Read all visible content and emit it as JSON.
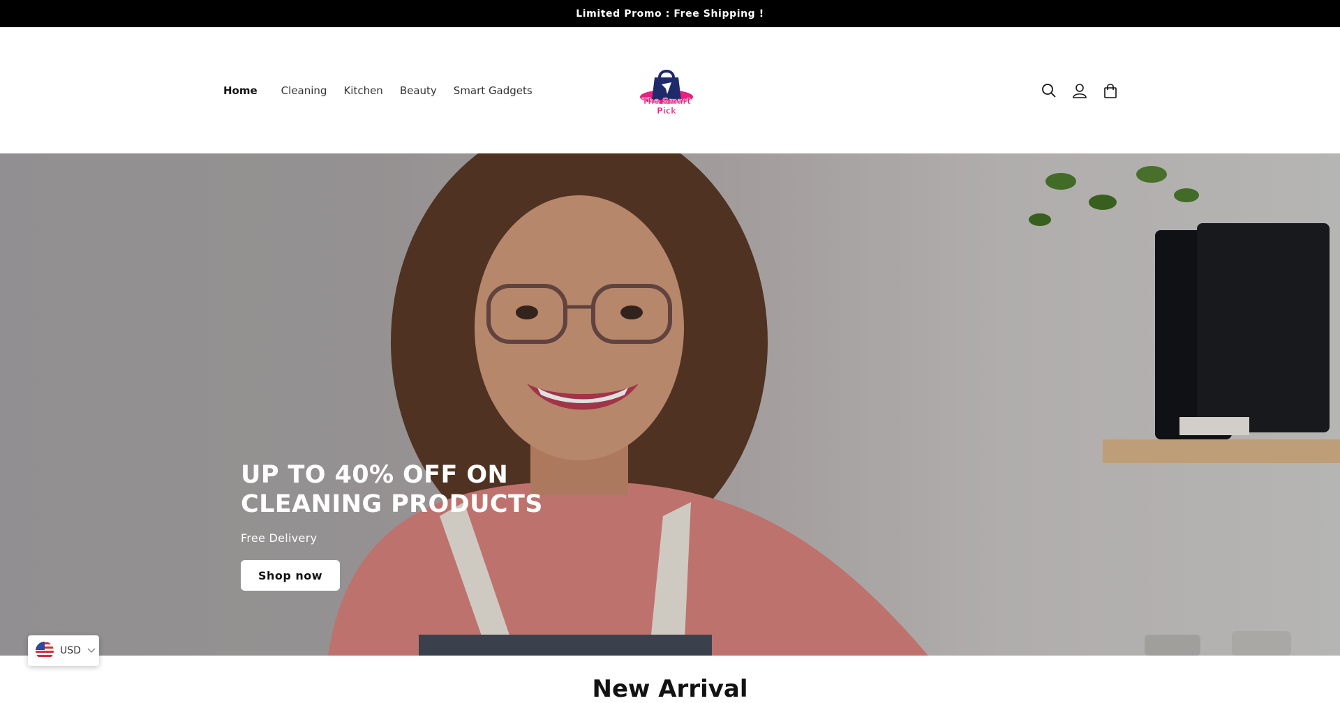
{
  "announcement": {
    "text": "Limited Promo : Free Shipping !"
  },
  "nav": {
    "items": [
      {
        "label": "Home",
        "active": true
      },
      {
        "label": "Cleaning"
      },
      {
        "label": "Kitchen"
      },
      {
        "label": "Beauty"
      },
      {
        "label": "Smart Gadgets"
      }
    ]
  },
  "logo": {
    "text": "The Smart Pick",
    "colors": {
      "bag": "#1f2a6b",
      "accent": "#e8217f"
    }
  },
  "header_icons": [
    "search-icon",
    "account-icon",
    "cart-icon"
  ],
  "hero": {
    "title_line1": "UP TO 40% OFF ON",
    "title_line2": "CLEANING PRODUCTS",
    "subtitle": "Free Delivery",
    "button_label": "Shop now"
  },
  "currency": {
    "code": "USD",
    "flag": "us-flag-icon"
  },
  "section": {
    "title": "New Arrival"
  }
}
